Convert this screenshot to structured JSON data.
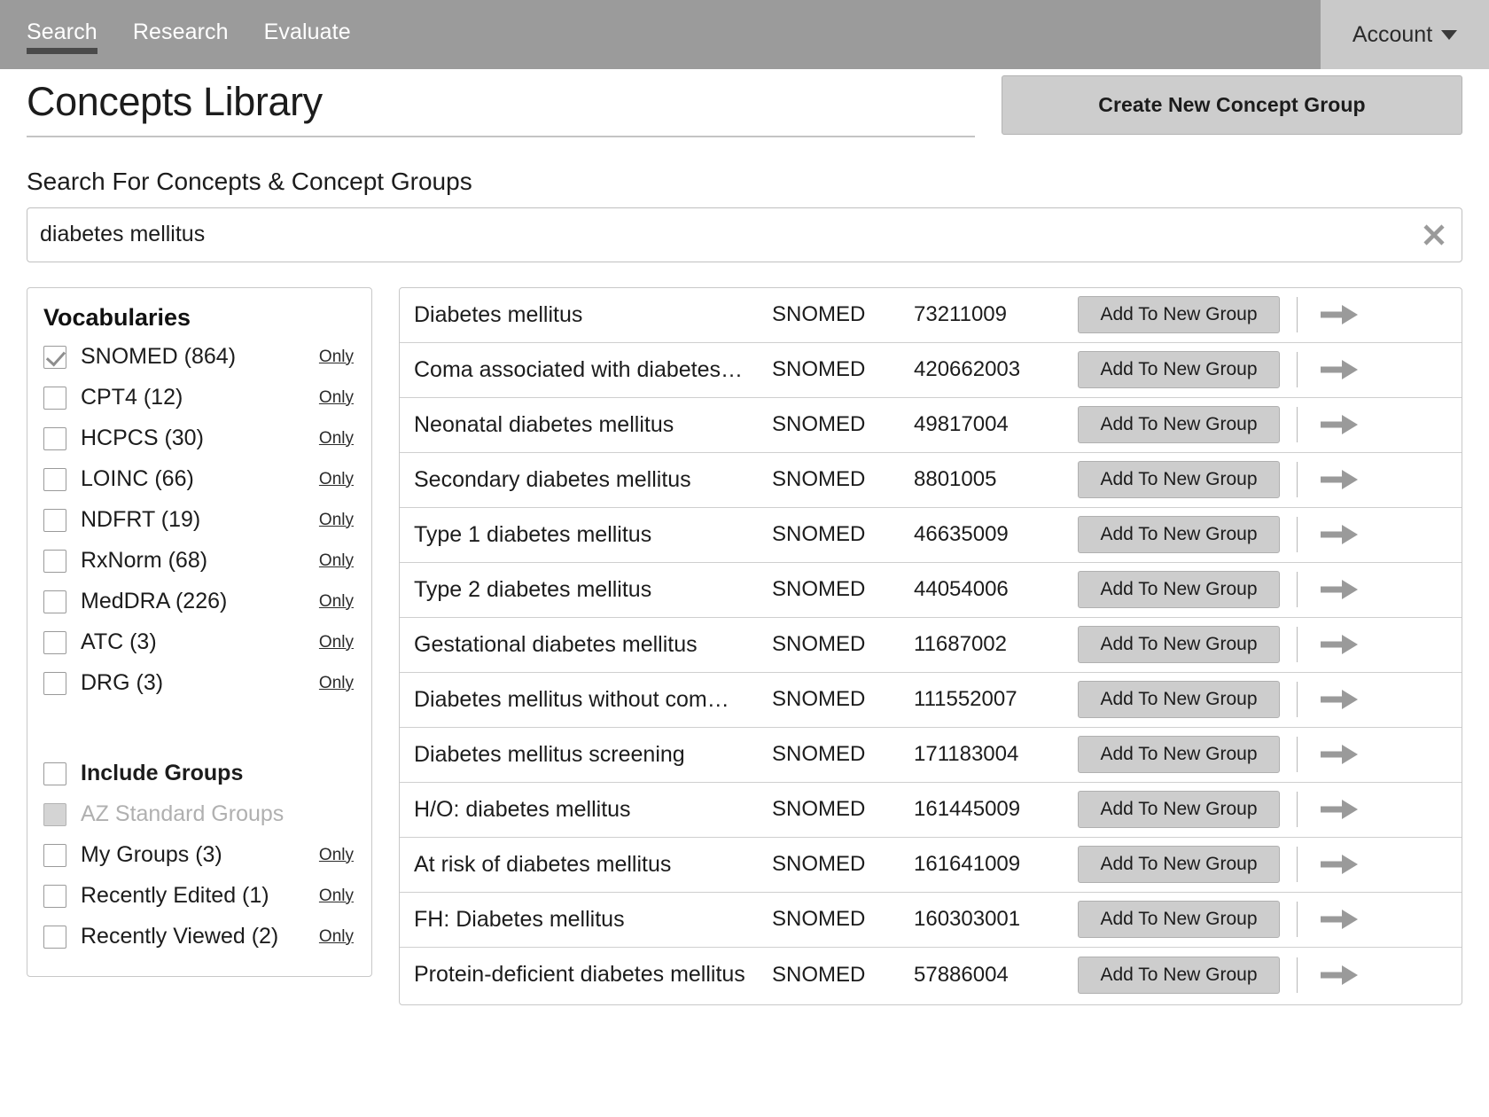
{
  "nav": {
    "tabs": [
      {
        "label": "Search",
        "active": true
      },
      {
        "label": "Research",
        "active": false
      },
      {
        "label": "Evaluate",
        "active": false
      }
    ],
    "account_label": "Account",
    "account_caret_icon": "caret-down-icon"
  },
  "header": {
    "title": "Concepts Library",
    "create_button_label": "Create New Concept Group"
  },
  "search": {
    "label": "Search For Concepts & Concept Groups",
    "value": "diabetes mellitus",
    "placeholder": "Search For Concepts & Concept Groups",
    "clear_icon": "close-icon"
  },
  "sidebar": {
    "heading": "Vocabularies",
    "only_label": "Only",
    "vocabularies": [
      {
        "label": "SNOMED (864)",
        "checked": true,
        "disabled": false,
        "only": true
      },
      {
        "label": "CPT4 (12)",
        "checked": false,
        "disabled": false,
        "only": true
      },
      {
        "label": "HCPCS (30)",
        "checked": false,
        "disabled": false,
        "only": true
      },
      {
        "label": "LOINC (66)",
        "checked": false,
        "disabled": false,
        "only": true
      },
      {
        "label": "NDFRT (19)",
        "checked": false,
        "disabled": false,
        "only": true
      },
      {
        "label": "RxNorm (68)",
        "checked": false,
        "disabled": false,
        "only": true
      },
      {
        "label": "MedDRA (226)",
        "checked": false,
        "disabled": false,
        "only": true
      },
      {
        "label": "ATC (3)",
        "checked": false,
        "disabled": false,
        "only": true
      },
      {
        "label": "DRG (3)",
        "checked": false,
        "disabled": false,
        "only": true
      }
    ],
    "groups": [
      {
        "label": "Include Groups",
        "checked": false,
        "disabled": false,
        "only": false,
        "bold": true
      },
      {
        "label": "AZ Standard Groups",
        "checked": false,
        "disabled": true,
        "only": false,
        "bold": false
      },
      {
        "label": "My Groups (3)",
        "checked": false,
        "disabled": false,
        "only": true,
        "bold": false
      },
      {
        "label": "Recently Edited (1)",
        "checked": false,
        "disabled": false,
        "only": true,
        "bold": false
      },
      {
        "label": "Recently Viewed (2)",
        "checked": false,
        "disabled": false,
        "only": true,
        "bold": false
      }
    ]
  },
  "results": {
    "add_button_label": "Add To New Group",
    "arrow_icon": "arrow-right-icon",
    "rows": [
      {
        "name": "Diabetes mellitus",
        "vocabulary": "SNOMED",
        "code": "73211009"
      },
      {
        "name": "Coma associated with diabetes…",
        "vocabulary": "SNOMED",
        "code": "420662003"
      },
      {
        "name": "Neonatal diabetes mellitus",
        "vocabulary": "SNOMED",
        "code": "49817004"
      },
      {
        "name": "Secondary diabetes mellitus",
        "vocabulary": "SNOMED",
        "code": "8801005"
      },
      {
        "name": "Type 1 diabetes mellitus",
        "vocabulary": "SNOMED",
        "code": "46635009"
      },
      {
        "name": "Type 2 diabetes mellitus",
        "vocabulary": "SNOMED",
        "code": "44054006"
      },
      {
        "name": "Gestational diabetes mellitus",
        "vocabulary": "SNOMED",
        "code": "11687002"
      },
      {
        "name": "Diabetes mellitus without com…",
        "vocabulary": "SNOMED",
        "code": "111552007"
      },
      {
        "name": "Diabetes mellitus screening",
        "vocabulary": "SNOMED",
        "code": "171183004"
      },
      {
        "name": "H/O: diabetes mellitus",
        "vocabulary": "SNOMED",
        "code": "161445009"
      },
      {
        "name": "At risk of diabetes mellitus",
        "vocabulary": "SNOMED",
        "code": "161641009"
      },
      {
        "name": "FH: Diabetes mellitus",
        "vocabulary": "SNOMED",
        "code": "160303001"
      },
      {
        "name": "Protein-deficient diabetes mellitus",
        "vocabulary": "SNOMED",
        "code": "57886004"
      }
    ]
  },
  "colors": {
    "nav_bg": "#9b9b9b",
    "account_bg": "#c9c9c9",
    "active_tab_underline": "#4a4a4a",
    "button_bg": "#cdcdcd",
    "border": "#c8c8c8",
    "arrow": "#9a9a9a"
  }
}
